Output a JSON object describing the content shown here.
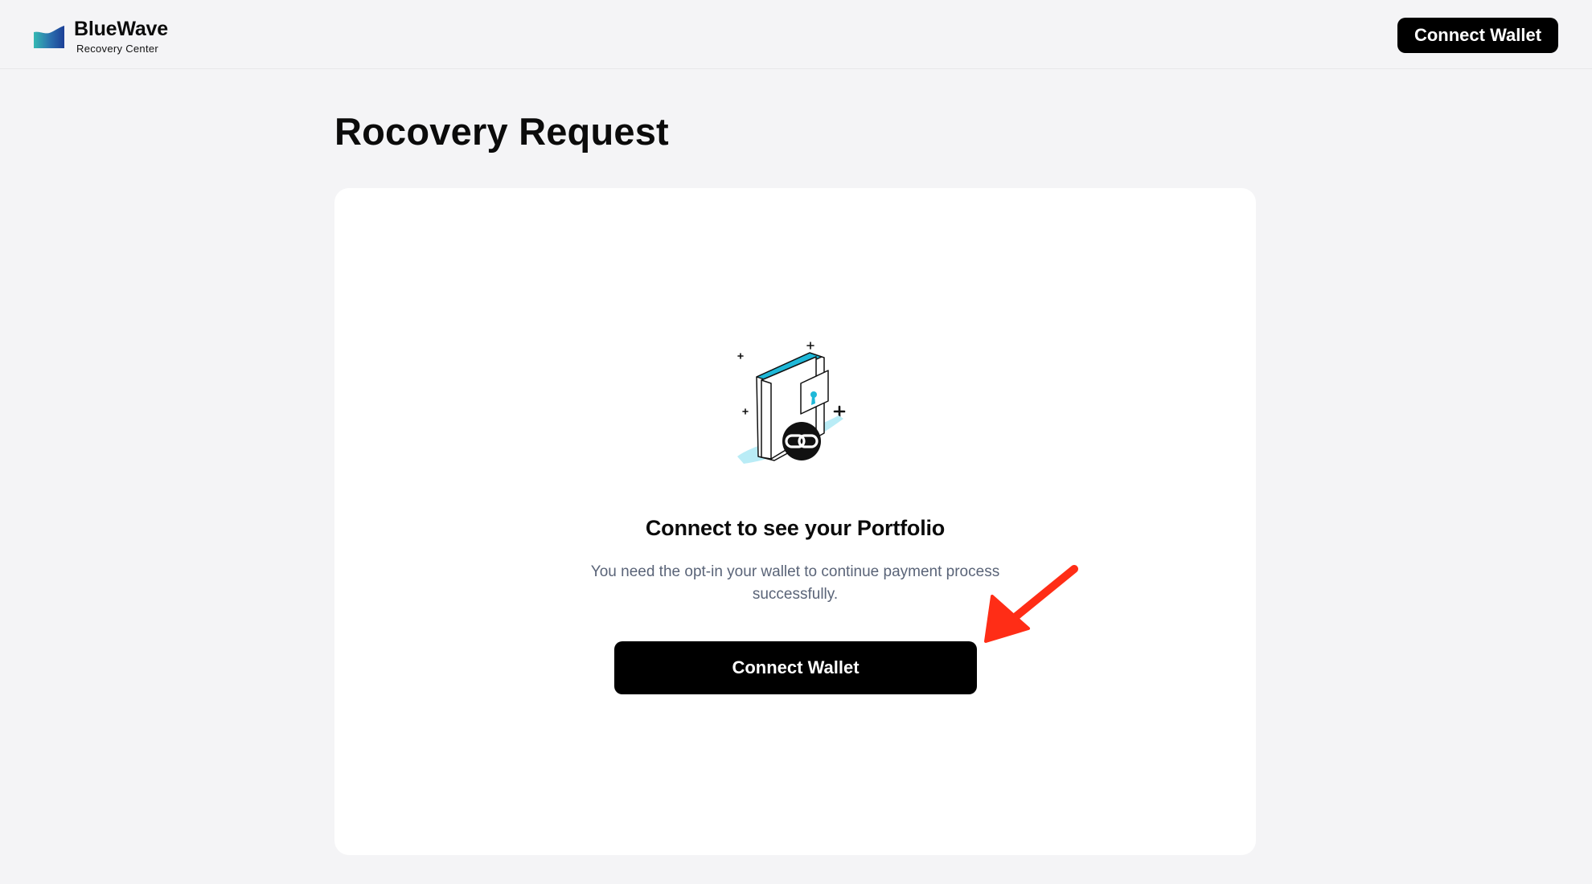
{
  "header": {
    "brand_name": "BlueWave",
    "brand_subtitle": "Recovery Center",
    "logo_icon": "wave-logo-icon",
    "connect_wallet_label": "Connect Wallet"
  },
  "page": {
    "title": "Rocovery Request"
  },
  "card": {
    "illustration_icon": "wallet-link-illustration-icon",
    "heading": "Connect to see your Portfolio",
    "description": "You need the opt-in your wallet to continue payment process successfully.",
    "connect_wallet_label": "Connect Wallet"
  },
  "colors": {
    "page_background": "#f4f4f6",
    "card_background": "#ffffff",
    "button_background": "#000000",
    "button_text": "#ffffff",
    "accent_cyan": "#1fb8d8",
    "annotation_arrow": "#ff2d16",
    "description_text": "#5a6478"
  }
}
